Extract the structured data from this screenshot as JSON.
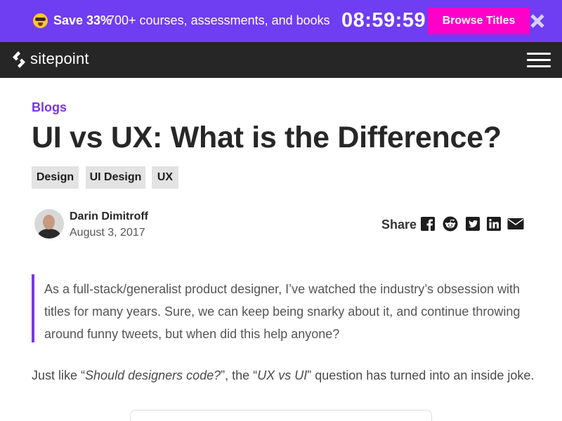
{
  "promo": {
    "emoji_icon": "sunglasses-face-icon",
    "save_text": "Save 33%",
    "offer_text": "700+ courses, assessments, and books",
    "timer": "08:59:59",
    "button_label": "Browse Titles",
    "close_icon": "close-icon",
    "background": "#6f3df2",
    "button_color": "#ff00c8"
  },
  "nav": {
    "logo_text": "sitepoint",
    "menu_icon": "hamburger-menu-icon"
  },
  "article": {
    "category": "Blogs",
    "title": "UI vs UX: What is the Difference?",
    "tags": [
      "Design",
      "UI Design",
      "UX"
    ],
    "author": {
      "name": "Darin Dimitroff",
      "date": "August 3, 2017"
    },
    "share": {
      "label": "Share",
      "icons": [
        "facebook-icon",
        "reddit-icon",
        "twitter-icon",
        "linkedin-icon",
        "email-icon"
      ]
    },
    "quote_lines": [
      "As a full-stack/generalist product designer, I’ve watched the industry’s obsession with",
      "titles for many years. Sure, we can keep being snarky about it, and continue throwing",
      "around funny tweets, but when did this help anyone?"
    ],
    "paragraph": {
      "part1": "Just like “",
      "italic1": "Should designers code?",
      "part2": "”, the “",
      "italic2": "UX vs UI",
      "part3": "” question has turned into an inside joke."
    },
    "accent_color": "#7b35e8"
  }
}
